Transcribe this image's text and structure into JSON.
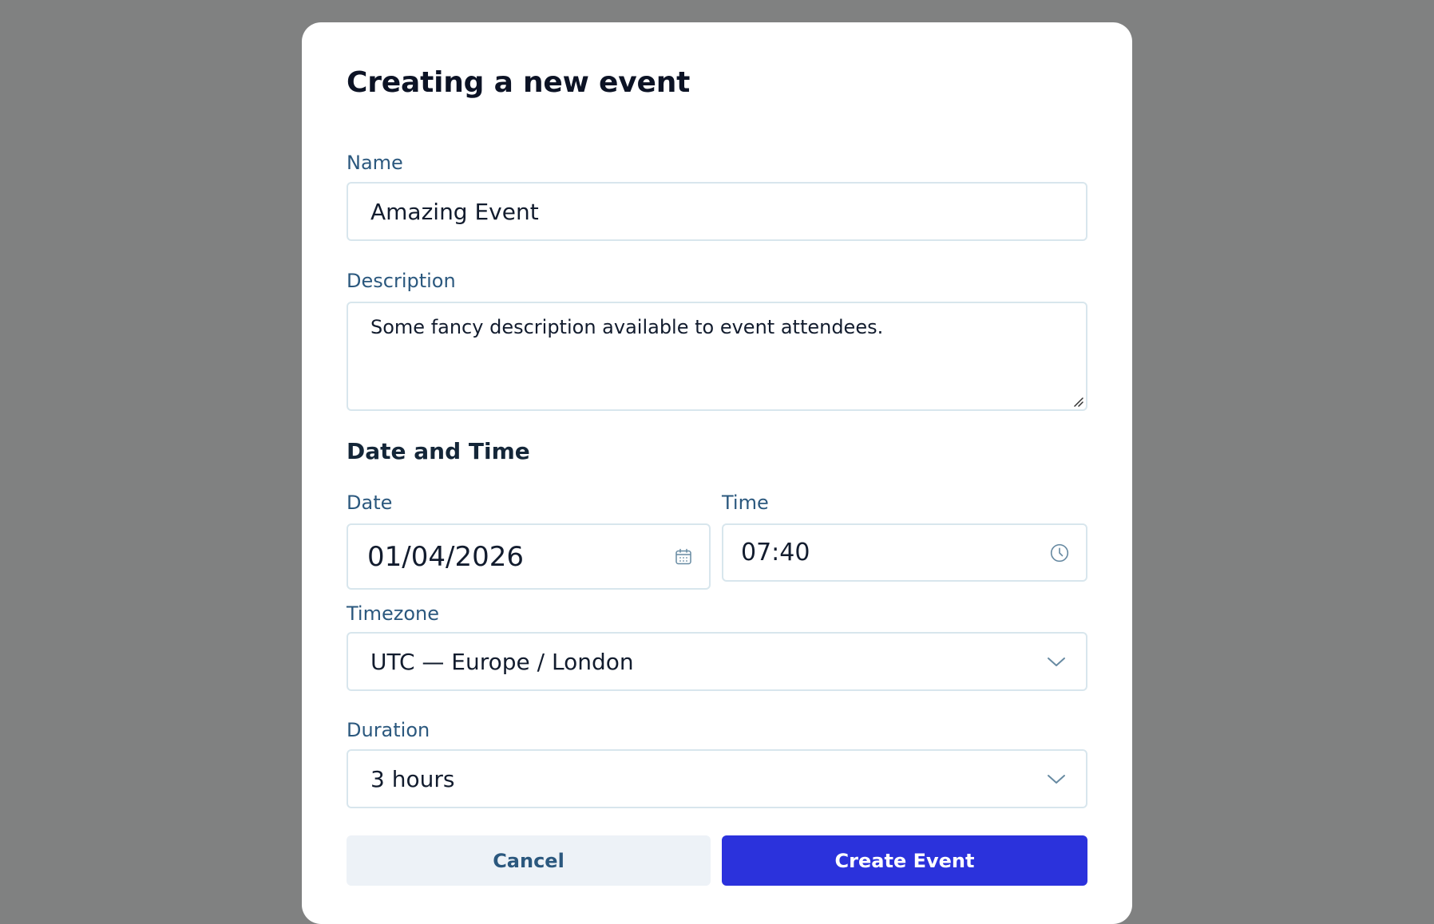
{
  "modal": {
    "title": "Creating a new event"
  },
  "form": {
    "name": {
      "label": "Name",
      "value": "Amazing Event"
    },
    "description": {
      "label": "Description",
      "value": "Some fancy description available to event attendees."
    },
    "date_time_section": {
      "heading": "Date and Time"
    },
    "date": {
      "label": "Date",
      "value": "01/04/2026",
      "icon": "calendar-icon"
    },
    "time": {
      "label": "Time",
      "value": "07:40",
      "icon": "clock-icon"
    },
    "timezone": {
      "label": "Timezone",
      "value": "UTC — Europe / London",
      "icon": "chevron-down-icon"
    },
    "duration": {
      "label": "Duration",
      "value": "3 hours",
      "icon": "chevron-down-icon"
    }
  },
  "actions": {
    "cancel_label": "Cancel",
    "create_label": "Create Event"
  },
  "colors": {
    "overlay": "#808181",
    "modal_background": "#ffffff",
    "label": "#2b587e",
    "primary_button": "#2b32dc",
    "secondary_button": "#edf2f7",
    "input_border": "#d8e6ed"
  }
}
